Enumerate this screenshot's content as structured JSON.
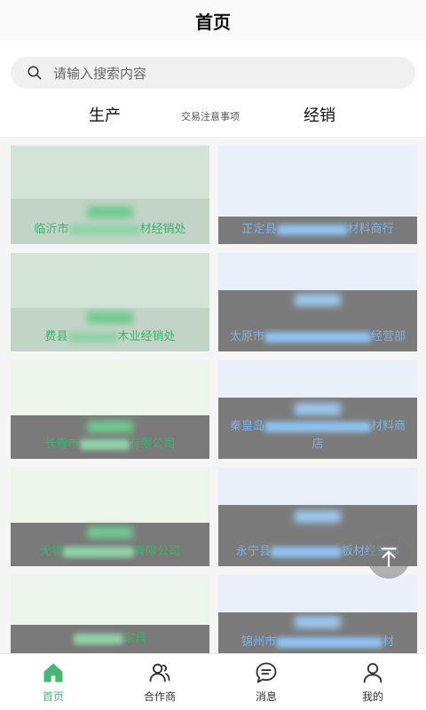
{
  "header": {
    "title": "首页"
  },
  "search": {
    "placeholder": "请输入搜索内容"
  },
  "tabs": {
    "production": "生产",
    "notice": "交易注意事项",
    "distribution": "经销"
  },
  "cards": [
    {
      "prefix": "临沂市",
      "suffix": "材经销处"
    },
    {
      "prefix": "正定县",
      "suffix": "材料商行"
    },
    {
      "prefix": "费县",
      "suffix": "木业经销处"
    },
    {
      "prefix": "太原市",
      "suffix": "经营部"
    },
    {
      "prefix": "长春市",
      "suffix": "有限公司"
    },
    {
      "prefix": "秦皇岛",
      "suffix": "材料商店"
    },
    {
      "prefix": "无锡",
      "suffix": "有限公司"
    },
    {
      "prefix": "永宁县",
      "suffix": "板材经销部"
    },
    {
      "prefix": "",
      "suffix": "家具"
    },
    {
      "prefix": "锦州市",
      "suffix": "材"
    }
  ],
  "tabbar": {
    "home": "首页",
    "partners": "合作商",
    "messages": "消息",
    "mine": "我的"
  },
  "colors": {
    "accent": "#48b76f",
    "secondary": "#7fb0e6"
  },
  "icons": [
    "search-icon",
    "home-icon",
    "partners-icon",
    "messages-icon",
    "mine-icon",
    "back-to-top-icon"
  ]
}
